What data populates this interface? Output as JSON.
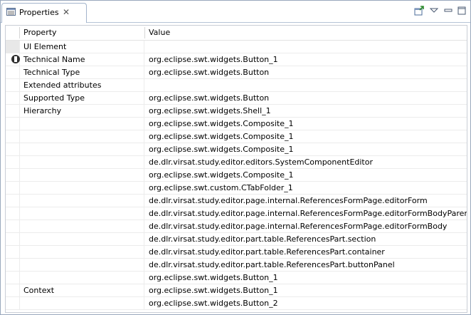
{
  "view": {
    "tab_label": "Properties",
    "toolbar_icons": [
      "pin-icon",
      "view-menu-icon",
      "minimize-icon",
      "maximize-icon"
    ]
  },
  "table": {
    "columns": [
      "Property",
      "Value"
    ],
    "rows": [
      {
        "property": "UI Element",
        "value": ""
      },
      {
        "property": "Technical Name",
        "value": "org.eclipse.swt.widgets.Button_1"
      },
      {
        "property": "Technical Type",
        "value": "org.eclipse.swt.widgets.Button"
      },
      {
        "property": "Extended attributes",
        "value": ""
      },
      {
        "property": "Supported Type",
        "value": "org.eclipse.swt.widgets.Button"
      },
      {
        "property": "Hierarchy",
        "value": "org.eclipse.swt.widgets.Shell_1"
      },
      {
        "property": "",
        "value": "org.eclipse.swt.widgets.Composite_1"
      },
      {
        "property": "",
        "value": "org.eclipse.swt.widgets.Composite_1"
      },
      {
        "property": "",
        "value": "org.eclipse.swt.widgets.Composite_1"
      },
      {
        "property": "",
        "value": "de.dlr.virsat.study.editor.editors.SystemComponentEditor"
      },
      {
        "property": "",
        "value": "org.eclipse.swt.widgets.Composite_1"
      },
      {
        "property": "",
        "value": "org.eclipse.swt.custom.CTabFolder_1"
      },
      {
        "property": "",
        "value": "de.dlr.virsat.study.editor.page.internal.ReferencesFormPage.editorForm"
      },
      {
        "property": "",
        "value": "de.dlr.virsat.study.editor.page.internal.ReferencesFormPage.editorFormBodyParent"
      },
      {
        "property": "",
        "value": "de.dlr.virsat.study.editor.page.internal.ReferencesFormPage.editorFormBody"
      },
      {
        "property": "",
        "value": "de.dlr.virsat.study.editor.part.table.ReferencesPart.section"
      },
      {
        "property": "",
        "value": "de.dlr.virsat.study.editor.part.table.ReferencesPart.container"
      },
      {
        "property": "",
        "value": "de.dlr.virsat.study.editor.part.table.ReferencesPart.buttonPanel"
      },
      {
        "property": "",
        "value": "org.eclipse.swt.widgets.Button_1"
      },
      {
        "property": "Context",
        "value": "org.eclipse.swt.widgets.Button_1"
      },
      {
        "property": "",
        "value": "org.eclipse.swt.widgets.Button_2"
      }
    ]
  }
}
